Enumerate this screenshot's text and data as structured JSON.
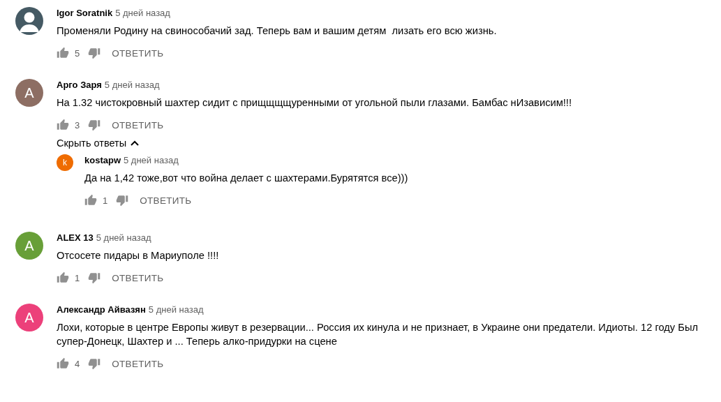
{
  "comments": [
    {
      "avatar": {
        "kind": "silhouette",
        "color": "#455a64"
      },
      "author": "Igor Soratnik",
      "time": "5 дней назад",
      "text": "Променяли Родину на свинособачий зад. Теперь вам и вашим детям  лизать его всю жизнь.",
      "likes": "5",
      "reply_label": "ОТВЕТИТЬ"
    },
    {
      "avatar": {
        "kind": "letter",
        "letter": "А",
        "color": "#8d6e63"
      },
      "author": "Арго Заря",
      "time": "5 дней назад",
      "text": "На 1.32 чистокровный шахтер сидит с прищщщщуренными от угольной пыли глазами. Бамбас нИзависим!!!",
      "likes": "3",
      "reply_label": "ОТВЕТИТЬ",
      "replies_toggle": {
        "label": "Скрыть ответы",
        "expanded": true
      },
      "replies": [
        {
          "avatar": {
            "kind": "letter",
            "letter": "k",
            "color": "#ef6c00"
          },
          "author": "kostapw",
          "time": "5 дней назад",
          "text": "Да на 1,42 тоже,вот что война делает с шахтерами.Бурятятся все)))",
          "likes": "1",
          "reply_label": "ОТВЕТИТЬ"
        }
      ]
    },
    {
      "avatar": {
        "kind": "letter",
        "letter": "A",
        "color": "#689f38"
      },
      "author": "ALEX 13",
      "time": "5 дней назад",
      "text": "Отсосете пидары в Мариуполе !!!!",
      "likes": "1",
      "reply_label": "ОТВЕТИТЬ"
    },
    {
      "avatar": {
        "kind": "letter",
        "letter": "А",
        "color": "#ec407a"
      },
      "author": "Александр Айвазян",
      "time": "5 дней назад",
      "text": "Лохи, которые в центре Европы живут в резервации... Россия их кинула и не признает, в Украине они предатели. Идиоты. 12 году Был супер-Донецк, Шахтер и ... Теперь алко-придурки на сцене",
      "likes": "4",
      "reply_label": "ОТВЕТИТЬ"
    }
  ]
}
